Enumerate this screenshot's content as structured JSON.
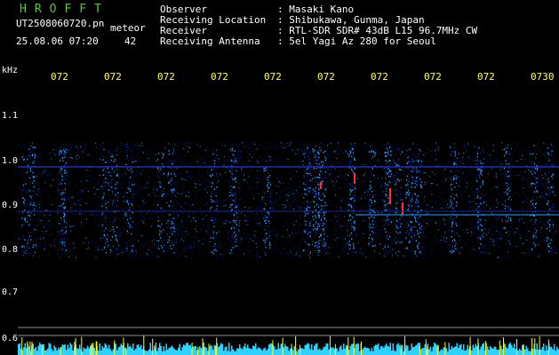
{
  "header": {
    "app_title": "HROFFT",
    "filename": "UT2508060720.pn",
    "mode": "meteor",
    "datetime": "25.08.06 07:20",
    "count": "42"
  },
  "station_info": [
    {
      "label": "Observer",
      "value": "Masaki Kano"
    },
    {
      "label": "Receiving Location",
      "value": "Shibukawa, Gunma, Japan"
    },
    {
      "label": "Receiver",
      "value": "RTL-SDR SDR# 43dB L15 96.7MHz CW"
    },
    {
      "label": "Receiving Antenna",
      "value": "5el Yagi Az 280 for Seoul"
    }
  ],
  "axes": {
    "y_unit": "kHz",
    "y_ticks": [
      "1.1",
      "1.0",
      "0.9",
      "0.8",
      "0.7",
      "0.6"
    ],
    "x_ticks": [
      "072",
      "072",
      "072",
      "072",
      "072",
      "072",
      "072",
      "072",
      "072",
      "0730"
    ]
  },
  "colors": {
    "background": "#000000",
    "title": "#58c830",
    "text": "#ffffff",
    "time_ticks": "#ffff66",
    "signal_low": "#1020a0",
    "signal_mid": "#30a0ff",
    "signal_high": "#ff3030",
    "power_trace": "#30d0ff",
    "power_peaks": "#ffff00"
  }
}
